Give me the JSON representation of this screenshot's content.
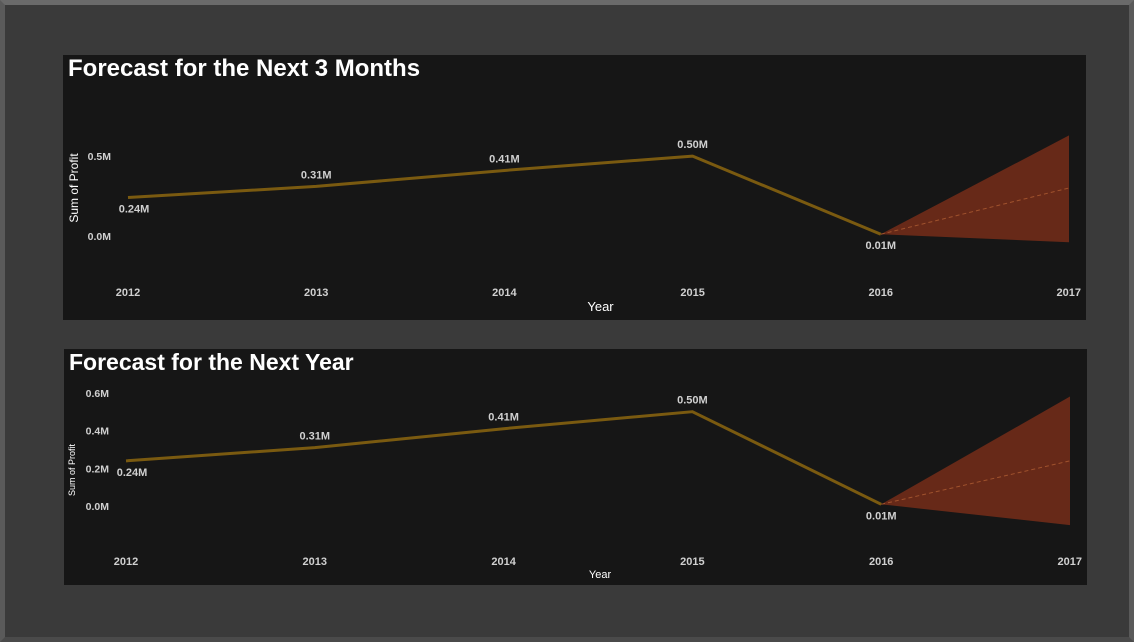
{
  "colors": {
    "line": "#7a5a10",
    "band": "#6b2a18",
    "forecast_line": "#a0522d",
    "label_text": "#d0d0d0",
    "title_text": "#ffffff"
  },
  "chart_data": [
    {
      "type": "line",
      "title": "Forecast for the Next 3 Months",
      "xlabel": "Year",
      "ylabel": "Sum of Profit",
      "x": [
        "2012",
        "2013",
        "2014",
        "2015",
        "2016",
        "2017"
      ],
      "series": [
        {
          "values": [
            0.24,
            0.31,
            0.41,
            0.5,
            0.01
          ]
        }
      ],
      "data_labels": [
        "0.24M",
        "0.31M",
        "0.41M",
        "0.50M",
        "0.01M"
      ],
      "forecast": {
        "x": [
          "2016",
          "2017"
        ],
        "mid": [
          0.01,
          0.3
        ],
        "upper": [
          0.01,
          0.63
        ],
        "lower": [
          0.01,
          -0.04
        ]
      },
      "yticks": [
        0.0,
        0.5
      ],
      "ytick_labels": [
        "0.0M",
        "0.5M"
      ],
      "ylim": [
        -0.07,
        0.72
      ],
      "grid": false
    },
    {
      "type": "line",
      "title": "Forecast for the Next Year",
      "xlabel": "Year",
      "ylabel": "Sum of Profit",
      "x": [
        "2012",
        "2013",
        "2014",
        "2015",
        "2016",
        "2017"
      ],
      "series": [
        {
          "values": [
            0.24,
            0.31,
            0.41,
            0.5,
            0.01
          ]
        }
      ],
      "data_labels": [
        "0.24M",
        "0.31M",
        "0.41M",
        "0.50M",
        "0.01M"
      ],
      "forecast": {
        "x": [
          "2016",
          "2017"
        ],
        "mid": [
          0.01,
          0.24
        ],
        "upper": [
          0.01,
          0.58
        ],
        "lower": [
          0.01,
          -0.1
        ]
      },
      "yticks": [
        0.0,
        0.2,
        0.4,
        0.6
      ],
      "ytick_labels": [
        "0.0M",
        "0.2M",
        "0.4M",
        "0.6M"
      ],
      "ylim": [
        -0.11,
        0.62
      ],
      "grid": false
    }
  ]
}
